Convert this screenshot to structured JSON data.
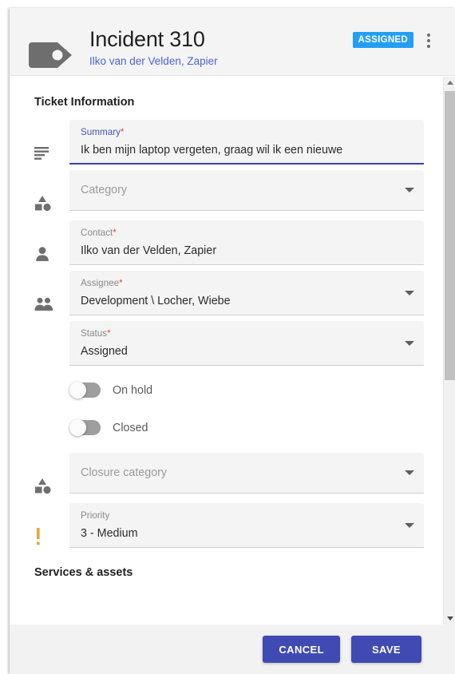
{
  "header": {
    "icon": "tag-icon",
    "title": "Incident 310",
    "subtitle": "Ilko van der Velden, Zapier",
    "status_badge": "ASSIGNED",
    "menu_icon": "kebab-menu-icon",
    "badge_color": "#239ef4",
    "subtitle_color": "#4a63d8"
  },
  "sections": {
    "ticket_information": "Ticket Information",
    "services_assets": "Services & assets"
  },
  "fields": {
    "summary": {
      "icon": "subject-lines-icon",
      "label": "Summary",
      "required": "*",
      "value": "Ik ben mijn laptop vergeten, graag wil ik een nieuwe",
      "focused": true
    },
    "category": {
      "icon": "shapes-category-icon",
      "label": "Category",
      "placeholder": "Category",
      "value": "",
      "has_dropdown": true
    },
    "contact": {
      "icon": "person-icon",
      "label": "Contact",
      "required": "*",
      "value": "Ilko van der Velden, Zapier",
      "has_dropdown": false
    },
    "assignee": {
      "icon": "people-group-icon",
      "label": "Assignee",
      "required": "*",
      "value": "Development \\ Locher, Wiebe",
      "has_dropdown": true
    },
    "status": {
      "icon": "",
      "label": "Status",
      "required": "*",
      "value": "Assigned",
      "has_dropdown": true
    },
    "closure_category": {
      "icon": "shapes-category-icon",
      "label": "Closure category",
      "placeholder": "Closure category",
      "value": "",
      "has_dropdown": true
    },
    "priority": {
      "icon": "exclamation-priority-icon",
      "label": "Priority",
      "value": "3 - Medium",
      "has_dropdown": true
    }
  },
  "toggles": {
    "on_hold": {
      "label": "On hold",
      "checked": false
    },
    "closed": {
      "label": "Closed",
      "checked": false
    }
  },
  "footer": {
    "cancel_label": "CANCEL",
    "save_label": "SAVE",
    "button_color": "#3f4ab3"
  },
  "scrollbar": {
    "up_icon": "scroll-up-arrow-icon",
    "down_icon": "scroll-down-arrow-icon"
  }
}
